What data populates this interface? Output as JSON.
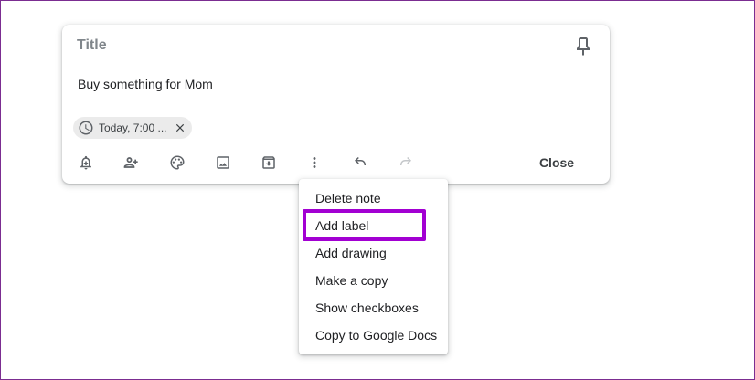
{
  "note": {
    "title_placeholder": "Title",
    "body": "Buy something for Mom",
    "reminder_chip": {
      "label": "Today, 7:00 ...",
      "icon": "clock-icon",
      "remove_icon": "close-icon"
    },
    "pin_icon": "pin-icon",
    "toolbar": {
      "icons": [
        "bell-plus-icon",
        "person-add-icon",
        "palette-icon",
        "image-icon",
        "archive-icon",
        "more-vert-icon",
        "undo-icon",
        "redo-icon"
      ],
      "close_label": "Close"
    }
  },
  "menu": {
    "items": [
      {
        "label": "Delete note"
      },
      {
        "label": "Add label",
        "highlighted": true
      },
      {
        "label": "Add drawing"
      },
      {
        "label": "Make a copy"
      },
      {
        "label": "Show checkboxes"
      },
      {
        "label": "Copy to Google Docs"
      }
    ]
  },
  "colors": {
    "highlight_border": "#a200d2",
    "frame_border": "#7b2d91",
    "icon": "#5f6368",
    "disabled_icon": "#c4c7ca",
    "chip_bg": "#ebebeb"
  }
}
